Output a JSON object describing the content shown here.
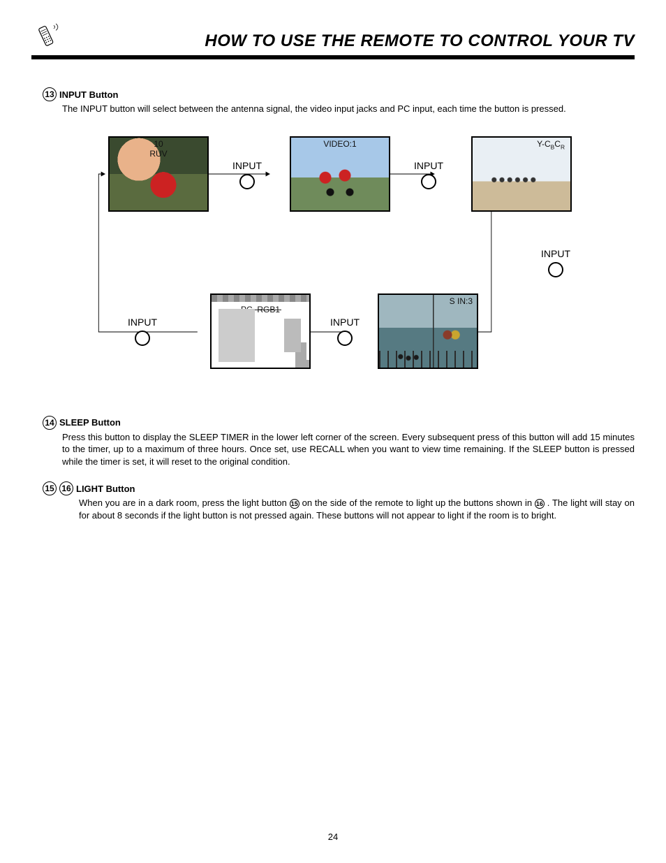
{
  "header": {
    "title": "HOW TO USE THE REMOTE TO CONTROL YOUR TV"
  },
  "sections": {
    "input": {
      "num": "13",
      "title": "INPUT Button",
      "body": "The INPUT button will select between the antenna signal, the video input jacks and PC input, each time the button is pressed."
    },
    "sleep": {
      "num": "14",
      "title": "SLEEP Button",
      "body": "Press this button to display the SLEEP TIMER in the lower left corner of the screen. Every subsequent press of this button will add 15 minutes to the timer, up to a maximum of three hours.  Once set, use RECALL when you want to view time remaining.  If the SLEEP button is pressed while the timer is set, it will reset to the original condition."
    },
    "light": {
      "num_a": "15",
      "num_b": "16",
      "title": "LIGHT Button",
      "body_pre": "When you are in a dark room, press the light button ",
      "inline_a": "15",
      "body_mid": " on the side of the remote to light up the buttons shown in ",
      "inline_b": "16",
      "body_post": ". The light will stay on for about 8 seconds if the light button is not pressed again. These buttons will not appear to light if the room is to bright."
    }
  },
  "diagram": {
    "node_label": "INPUT",
    "screens": {
      "antenna": {
        "line1": "10",
        "line2": "RUV"
      },
      "video": {
        "label": "VIDEO:1"
      },
      "component": {
        "label_html": "Y-C<sub>B</sub>C<sub>R</sub>"
      },
      "svideo": {
        "label": "S IN:3"
      },
      "pc": {
        "label": "PC. RGB1"
      }
    }
  },
  "page_number": "24"
}
